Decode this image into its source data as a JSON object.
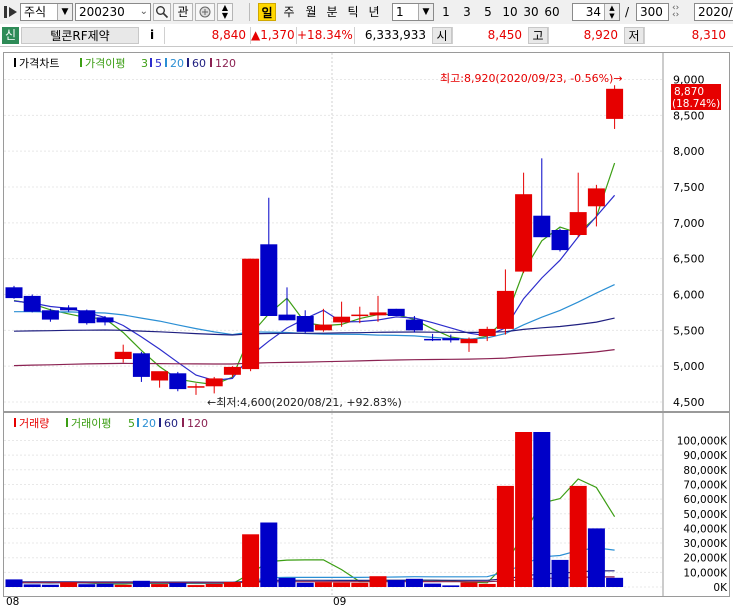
{
  "toolbar": {
    "market": "주식",
    "code": "200230",
    "buttons": [
      "관"
    ],
    "periods": [
      {
        "label": "일",
        "active": true
      },
      {
        "label": "주",
        "active": false
      },
      {
        "label": "월",
        "active": false
      },
      {
        "label": "분",
        "active": false
      },
      {
        "label": "틱",
        "active": false
      },
      {
        "label": "년",
        "active": false
      }
    ],
    "interval_value": "1",
    "quick_intervals": [
      "1",
      "3",
      "5",
      "10",
      "30",
      "60"
    ],
    "view_count": "34",
    "view_slash": "/",
    "total_count": "300",
    "date_value": "2020/"
  },
  "quote": {
    "badge": "신",
    "name": "텔콘RF제약",
    "info": "i",
    "price": "8,840",
    "change": "▲1,370",
    "change_rate": "+18.34%",
    "volume": "6,333,933",
    "open_label": "시",
    "open": "8,450",
    "high_label": "고",
    "high": "8,920",
    "low_label": "저",
    "low": "8,310"
  },
  "price_legend": {
    "title": "가격차트",
    "ma_label": "가격이평",
    "periods": [
      "3",
      "5",
      "20",
      "60",
      "120"
    ]
  },
  "volume_legend": {
    "title": "거래량",
    "ma_label": "거래이평",
    "periods": [
      "5",
      "20",
      "60",
      "120"
    ]
  },
  "annotations": {
    "high": "최고:8,920(2020/09/23, -0.56%)→",
    "low": "←최저:4,600(2020/08/21, +92.83%)",
    "current_price": "8,870",
    "current_rate": "(18.74%)"
  },
  "colors": {
    "up": "#e60000",
    "down": "#0000c8",
    "ma3": "#3c9e14",
    "ma5": "#2d2dcc",
    "ma20": "#2b8fd4",
    "ma60": "#202080",
    "ma120": "#8b2252"
  },
  "chart_data": [
    {
      "type": "candlestick",
      "title": "가격차트",
      "x_labels": [
        "08",
        "09"
      ],
      "ylim": [
        4400,
        9300
      ],
      "y_ticks": [
        "9,000",
        "8,500",
        "8,000",
        "7,500",
        "7,000",
        "6,500",
        "6,000",
        "5,500",
        "5,000",
        "4,500"
      ],
      "candles": [
        {
          "o": 6100,
          "h": 6120,
          "l": 5940,
          "c": 5950
        },
        {
          "o": 5980,
          "h": 6000,
          "l": 5750,
          "c": 5760
        },
        {
          "o": 5780,
          "h": 5800,
          "l": 5620,
          "c": 5650
        },
        {
          "o": 5820,
          "h": 5850,
          "l": 5760,
          "c": 5780
        },
        {
          "o": 5780,
          "h": 5790,
          "l": 5580,
          "c": 5600
        },
        {
          "o": 5680,
          "h": 5700,
          "l": 5570,
          "c": 5610
        },
        {
          "o": 5100,
          "h": 5300,
          "l": 5050,
          "c": 5200
        },
        {
          "o": 5180,
          "h": 5200,
          "l": 4780,
          "c": 4850
        },
        {
          "o": 4800,
          "h": 4900,
          "l": 4700,
          "c": 4930
        },
        {
          "o": 4900,
          "h": 4920,
          "l": 4650,
          "c": 4680
        },
        {
          "o": 4700,
          "h": 4760,
          "l": 4600,
          "c": 4720
        },
        {
          "o": 4720,
          "h": 4850,
          "l": 4620,
          "c": 4830
        },
        {
          "o": 4880,
          "h": 5000,
          "l": 4850,
          "c": 4990
        },
        {
          "o": 4960,
          "h": 6500,
          "l": 4930,
          "c": 6500
        },
        {
          "o": 6700,
          "h": 7350,
          "l": 5700,
          "c": 5700
        },
        {
          "o": 5720,
          "h": 6100,
          "l": 5640,
          "c": 5640
        },
        {
          "o": 5700,
          "h": 5780,
          "l": 5460,
          "c": 5480
        },
        {
          "o": 5500,
          "h": 5800,
          "l": 5480,
          "c": 5580
        },
        {
          "o": 5610,
          "h": 5900,
          "l": 5550,
          "c": 5690
        },
        {
          "o": 5700,
          "h": 5830,
          "l": 5600,
          "c": 5720
        },
        {
          "o": 5710,
          "h": 5980,
          "l": 5620,
          "c": 5750
        },
        {
          "o": 5800,
          "h": 5800,
          "l": 5700,
          "c": 5700
        },
        {
          "o": 5650,
          "h": 5700,
          "l": 5470,
          "c": 5500
        },
        {
          "o": 5380,
          "h": 5450,
          "l": 5350,
          "c": 5360
        },
        {
          "o": 5390,
          "h": 5440,
          "l": 5330,
          "c": 5360
        },
        {
          "o": 5320,
          "h": 5400,
          "l": 5200,
          "c": 5380
        },
        {
          "o": 5420,
          "h": 5550,
          "l": 5350,
          "c": 5520
        },
        {
          "o": 5520,
          "h": 6350,
          "l": 5440,
          "c": 6050
        },
        {
          "o": 6320,
          "h": 7700,
          "l": 6300,
          "c": 7400
        },
        {
          "o": 7100,
          "h": 7900,
          "l": 6800,
          "c": 6800
        },
        {
          "o": 6900,
          "h": 6920,
          "l": 6600,
          "c": 6620
        },
        {
          "o": 6830,
          "h": 7700,
          "l": 6800,
          "c": 7150
        },
        {
          "o": 7230,
          "h": 7530,
          "l": 6950,
          "c": 7480
        },
        {
          "o": 8450,
          "h": 8920,
          "l": 8310,
          "c": 8870
        }
      ]
    },
    {
      "type": "bar",
      "title": "거래량",
      "x_labels": [
        "08",
        "09"
      ],
      "ylim": [
        0,
        115000
      ],
      "y_ticks": [
        "100,000K",
        "90,000K",
        "80,000K",
        "70,000K",
        "60,000K",
        "50,000K",
        "40,000K",
        "30,000K",
        "20,000K",
        "10,000K",
        "0K"
      ],
      "values": [
        5200,
        1800,
        1600,
        3200,
        1900,
        2100,
        1500,
        4200,
        2000,
        2800,
        1300,
        2100,
        3400,
        36000,
        44000,
        6200,
        2900,
        3300,
        3100,
        2900,
        7400,
        4700,
        5600,
        2300,
        1100,
        3100,
        2100,
        69000,
        106000,
        106000,
        18500,
        69000,
        40000,
        6300
      ],
      "up": [
        false,
        false,
        false,
        true,
        false,
        false,
        true,
        false,
        true,
        false,
        true,
        true,
        true,
        true,
        false,
        false,
        false,
        true,
        true,
        true,
        true,
        false,
        false,
        false,
        false,
        true,
        true,
        true,
        true,
        false,
        false,
        true,
        false,
        false
      ]
    }
  ]
}
